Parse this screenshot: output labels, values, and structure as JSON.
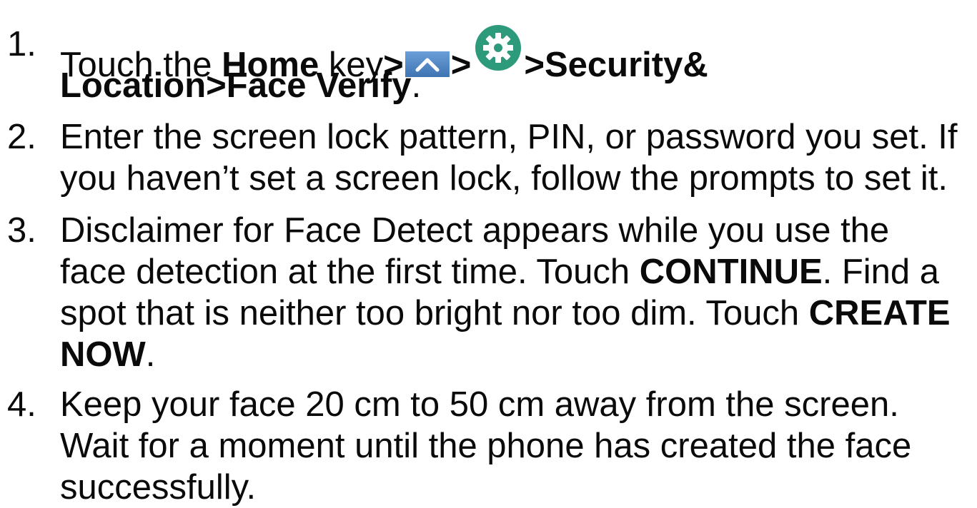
{
  "steps": [
    {
      "number": "1.",
      "line1": {
        "t1": "Touch the ",
        "b1": "Home",
        "t2": " key",
        "b2": ">",
        "b3": ">",
        "b4": ">Security&"
      },
      "line2": {
        "b1": "Location>Face Verify",
        "t1": "."
      },
      "icons": [
        "up-arrow-icon",
        "settings-gear-icon"
      ]
    },
    {
      "number": "2.",
      "line1": "Enter the screen lock pattern, PIN, or password you set. If",
      "line2": "you haven’t set a screen lock, follow the prompts to set it."
    },
    {
      "number": "3.",
      "line1": "Disclaimer for Face Detect appears while you use the",
      "line2": {
        "t1": "face detection at the first time. Touch ",
        "b1": "CONTINUE",
        "t2": ". Find a"
      },
      "line3": {
        "t1": "spot that is neither too bright nor too dim. Touch ",
        "b1": "CREATE"
      },
      "line4": {
        "b1": "NOW",
        "t1": "."
      }
    },
    {
      "number": "4.",
      "line1": "Keep your face 20 cm to 50 cm away from the screen.",
      "line2": "Wait for a moment until the phone has created the face",
      "line3": "successfully."
    }
  ],
  "colors": {
    "text": "#0a0a0a",
    "up_icon_bg": "#4f86c6",
    "gear_icon_bg": "#2e9a7c"
  }
}
